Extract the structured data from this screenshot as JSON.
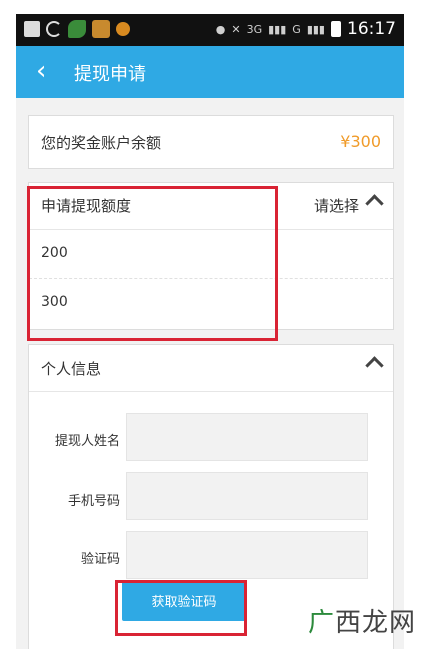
{
  "status_bar": {
    "time": "16:17",
    "signal_label_1": "3G",
    "signal_label_2": "G"
  },
  "header": {
    "back_icon": "chevron-left-icon",
    "title": "提现申请"
  },
  "balance": {
    "label": "您的奖金账户余额",
    "value": "¥300"
  },
  "amount_section": {
    "label": "申请提现额度",
    "select_label": "请选择",
    "options": [
      "200",
      "300"
    ]
  },
  "personal_info": {
    "title": "个人信息",
    "fields": [
      {
        "label": "提现人姓名",
        "value": ""
      },
      {
        "label": "手机号码",
        "value": ""
      },
      {
        "label": "验证码",
        "value": ""
      }
    ],
    "get_code_button": "获取验证码"
  },
  "watermark": {
    "text_a": "广",
    "text_b": "西龙网"
  },
  "colors": {
    "accent": "#2fa9e4",
    "balance": "#f09b2a",
    "highlight_box": "#d92334"
  }
}
